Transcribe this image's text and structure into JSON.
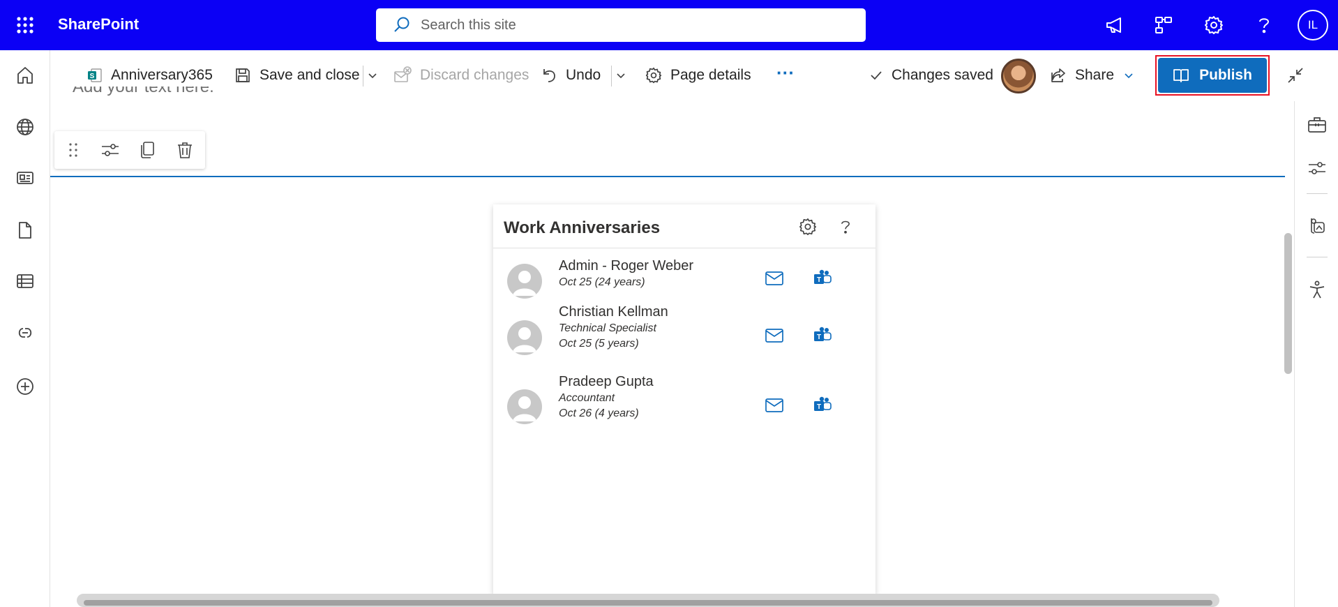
{
  "suite": {
    "brand": "SharePoint",
    "search_placeholder": "Search this site",
    "user_initials": "IL",
    "icons": [
      "app-launcher-icon",
      "search-icon",
      "megaphone-icon",
      "share-network-icon",
      "gear-icon",
      "help-icon"
    ]
  },
  "left_rail": [
    "home-icon",
    "globe-icon",
    "news-icon",
    "document-icon",
    "list-icon",
    "loop-icon",
    "add-icon"
  ],
  "command_bar": {
    "site_name": "Anniversary365",
    "save_and_close": "Save and close",
    "discard_changes": "Discard changes",
    "undo": "Undo",
    "page_details": "Page details",
    "more": "···",
    "changes_saved": "Changes saved",
    "share": "Share",
    "publish": "Publish"
  },
  "canvas": {
    "placeholder_text": "Add your text here."
  },
  "webpart": {
    "title": "Work Anniversaries",
    "people": [
      {
        "name": "Admin - Roger Weber",
        "title": "",
        "anniversary": "Oct 25 (24 years)"
      },
      {
        "name": "Christian Kellman",
        "title": "Technical Specialist",
        "anniversary": "Oct 25 (5 years)"
      },
      {
        "name": "Pradeep Gupta",
        "title": "Accountant",
        "anniversary": "Oct 26 (4 years)"
      }
    ]
  },
  "right_rail": [
    "toolbox-icon",
    "properties-icon",
    "design-ideas-icon",
    "accessibility-icon"
  ],
  "colors": {
    "suite_bar": "#0b00f5",
    "accent": "#0f6cbd",
    "highlight_border": "#e81123"
  }
}
